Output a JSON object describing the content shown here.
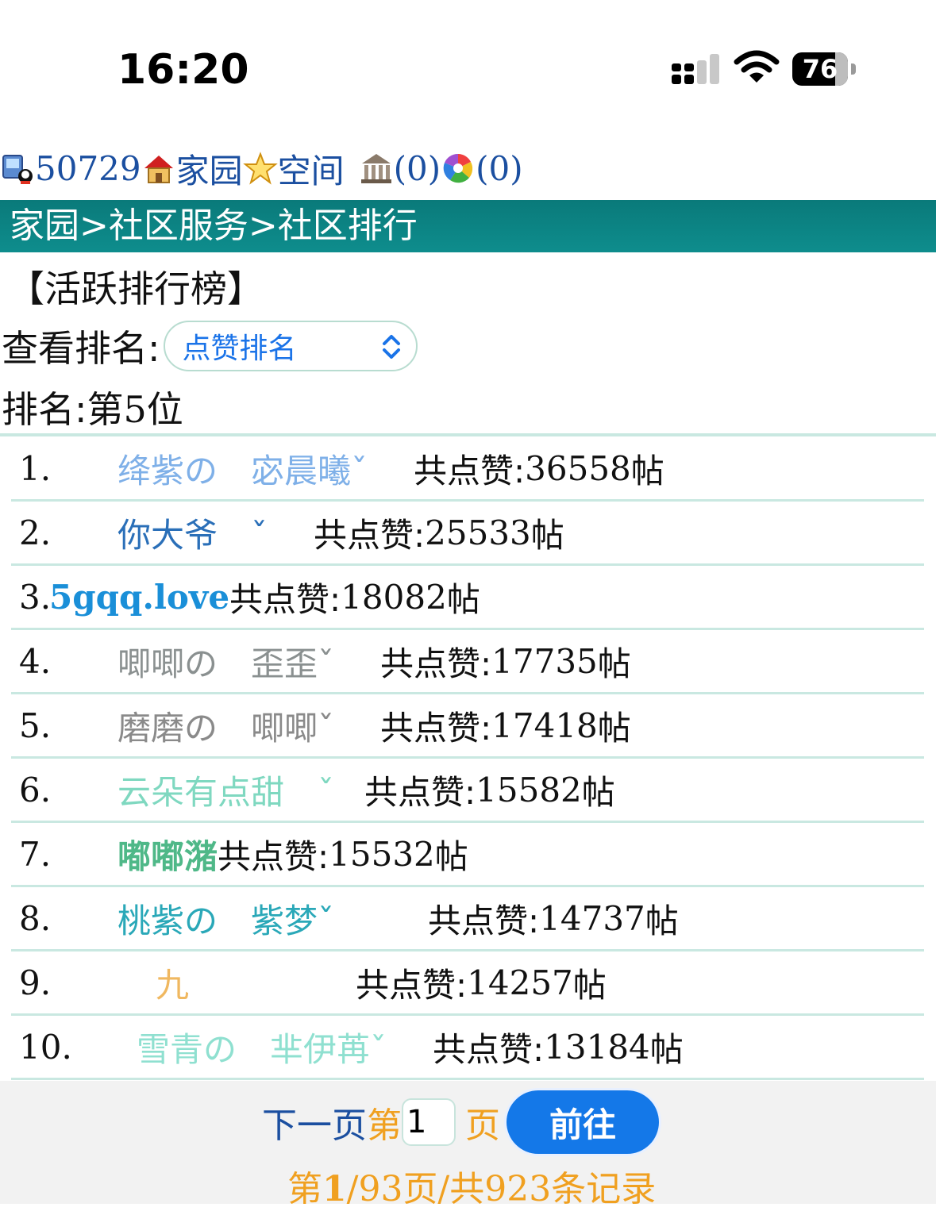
{
  "status_bar": {
    "time": "16:20",
    "battery": "76"
  },
  "topbar": {
    "user_id": "50729",
    "home_link": "家园",
    "space_link": "空间",
    "bank_count": "(0)",
    "photo_count": "(0)"
  },
  "breadcrumb": "家园>社区服务>社区排行",
  "board_title": "【活跃排行榜】",
  "view_rank": {
    "label": "查看排名:",
    "selected": "点赞排名"
  },
  "my_rank": {
    "prefix": "排名:第",
    "value": "5",
    "suffix": "位"
  },
  "like_label": "共点赞:",
  "unit": "帖",
  "ranking": [
    {
      "idx": "1.",
      "name": "绛紫の　宓晨曦ˇ",
      "count": "36558",
      "name_color": "#7fb0e8"
    },
    {
      "idx": "2.",
      "name": "你大爷　ˇ",
      "count": "25533",
      "name_color": "#2a6fb8"
    },
    {
      "idx": "3.",
      "name": "5gqq.love",
      "count": "18082",
      "name_color": "#1a8fd8"
    },
    {
      "idx": "4.",
      "name": "唧唧の　歪歪ˇ",
      "count": "17735",
      "name_color": "#8a9090"
    },
    {
      "idx": "5.",
      "name": "磨磨の　唧唧ˇ",
      "count": "17418",
      "name_color": "#8a8a8a"
    },
    {
      "idx": "6.",
      "name": "云朵有点甜　ˇ",
      "count": "15582",
      "name_color": "#7fd8c0"
    },
    {
      "idx": "7.",
      "name": "嘟嘟潴",
      "count": "15532",
      "name_color": "#4fb888"
    },
    {
      "idx": "8.",
      "name": "桃紫の　紫梦ˇ",
      "count": "14737",
      "name_color": "#2aa8b8"
    },
    {
      "idx": "9.",
      "name": "九",
      "count": "14257",
      "name_color": "#f0b860"
    },
    {
      "idx": "10.",
      "name": "雪青の　芈伊苒ˇ",
      "count": "13184",
      "name_color": "#8fe0d0"
    }
  ],
  "pager": {
    "next": "下一页",
    "page_prefix": "第",
    "page_value": "1",
    "page_suffix": "页",
    "go": "前往",
    "summary_prefix": "第",
    "current_page": "1",
    "summary_rest": "/93页/共923条记录"
  },
  "colors": {
    "header_bg": "#0a7a7a",
    "accent": "#1478e8",
    "orange": "#f0a020",
    "link": "#1b4fa0"
  }
}
